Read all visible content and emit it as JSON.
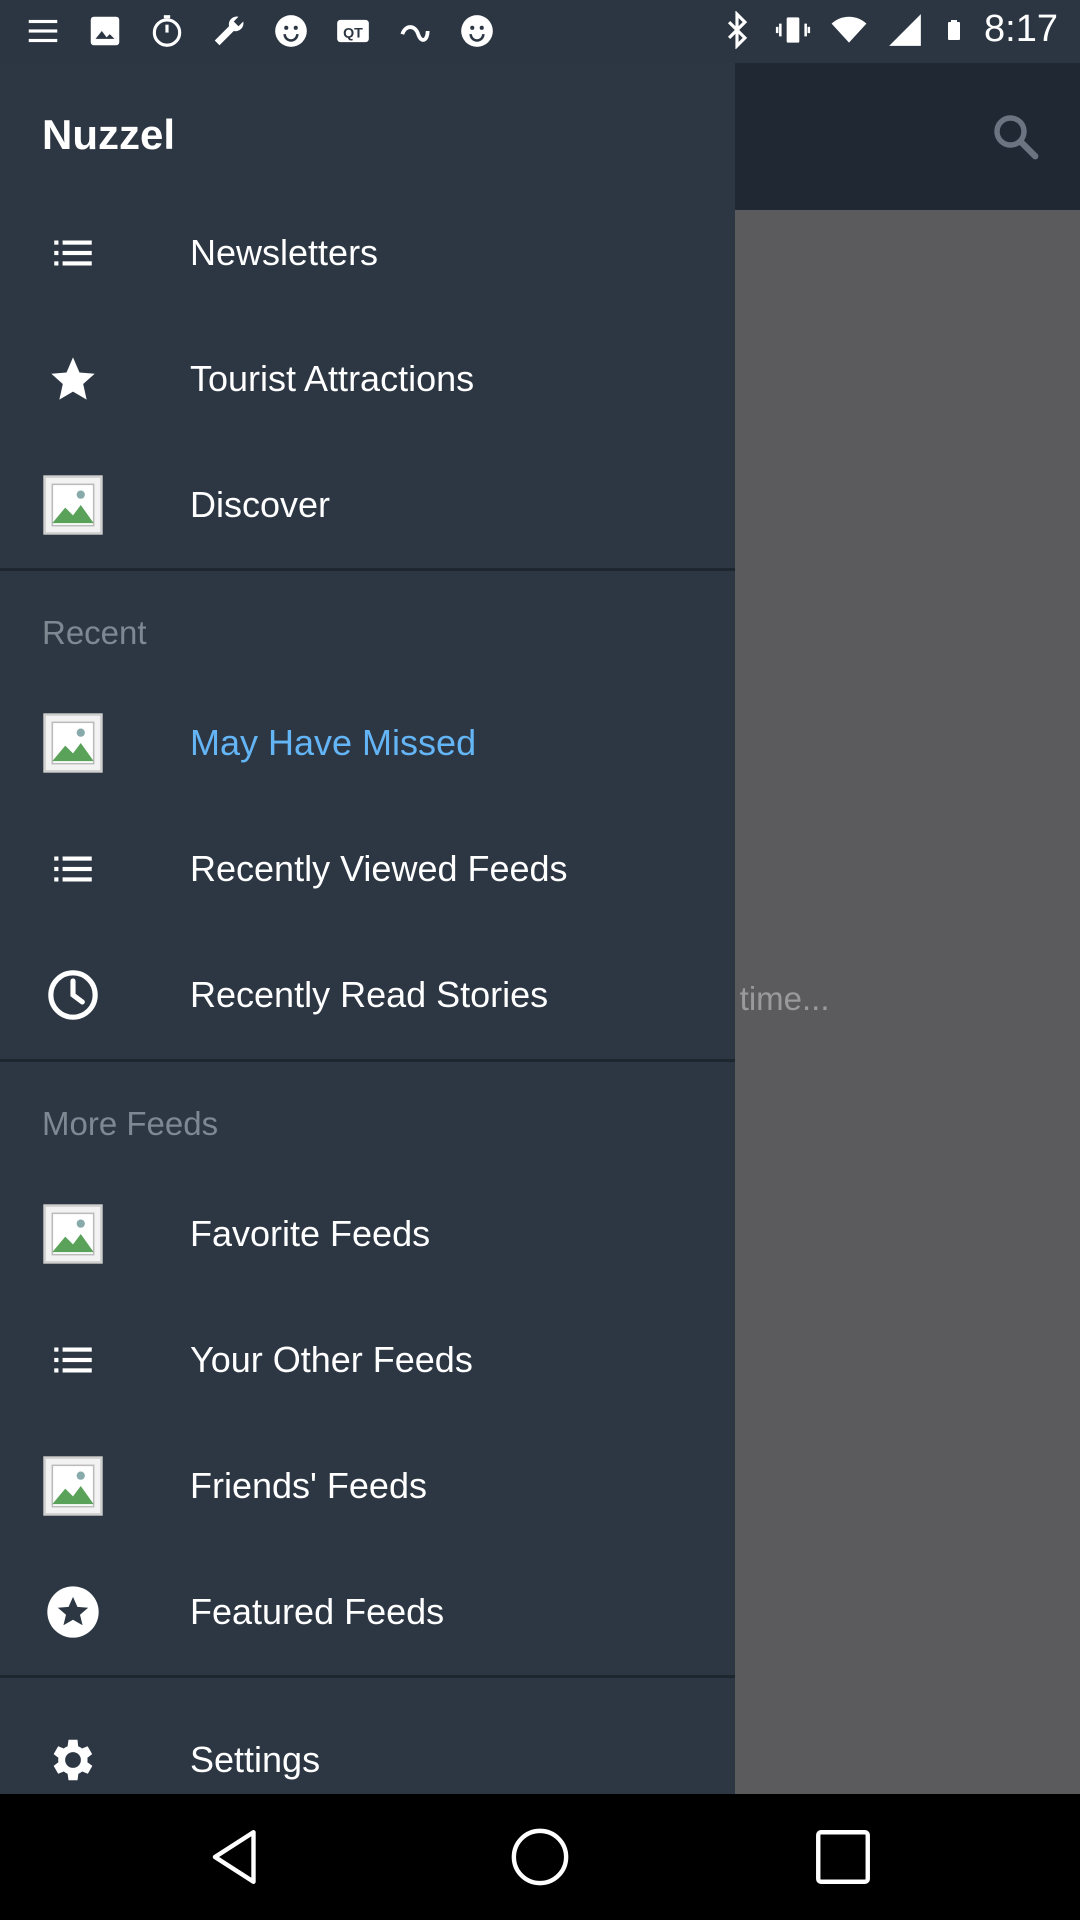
{
  "status_bar": {
    "time": "8:17",
    "left_icons": [
      "menu-icon",
      "image-icon",
      "timer-icon",
      "wrench-icon",
      "smiley-icon",
      "qr-icon",
      "data-saver-icon",
      "smiley-icon"
    ],
    "right_icons": [
      "bluetooth-icon",
      "vibrate-icon",
      "wifi-icon",
      "signal-icon",
      "battery-icon"
    ]
  },
  "app": {
    "title": "Nuzzel",
    "background_text": "s time..."
  },
  "drawer": {
    "items_main": [
      {
        "label": "Newsletters",
        "icon": "list-icon"
      },
      {
        "label": "Tourist Attractions",
        "icon": "star-icon"
      },
      {
        "label": "Discover",
        "icon": "image-placeholder-icon"
      }
    ],
    "recent_header": "Recent",
    "items_recent": [
      {
        "label": "May Have Missed",
        "icon": "image-placeholder-icon",
        "active": true
      },
      {
        "label": "Recently Viewed Feeds",
        "icon": "list-icon"
      },
      {
        "label": "Recently Read Stories",
        "icon": "clock-icon"
      }
    ],
    "more_header": "More Feeds",
    "items_more": [
      {
        "label": "Favorite Feeds",
        "icon": "image-placeholder-icon"
      },
      {
        "label": "Your Other Feeds",
        "icon": "list-icon"
      },
      {
        "label": "Friends' Feeds",
        "icon": "image-placeholder-icon"
      },
      {
        "label": "Featured Feeds",
        "icon": "star-circle-icon"
      }
    ],
    "settings_label": "Settings"
  },
  "colors": {
    "drawer_bg": "#2d3744",
    "appbar_bg": "#1f2833",
    "active_text": "#64b5f6",
    "scrim": "#5b5b5d"
  }
}
